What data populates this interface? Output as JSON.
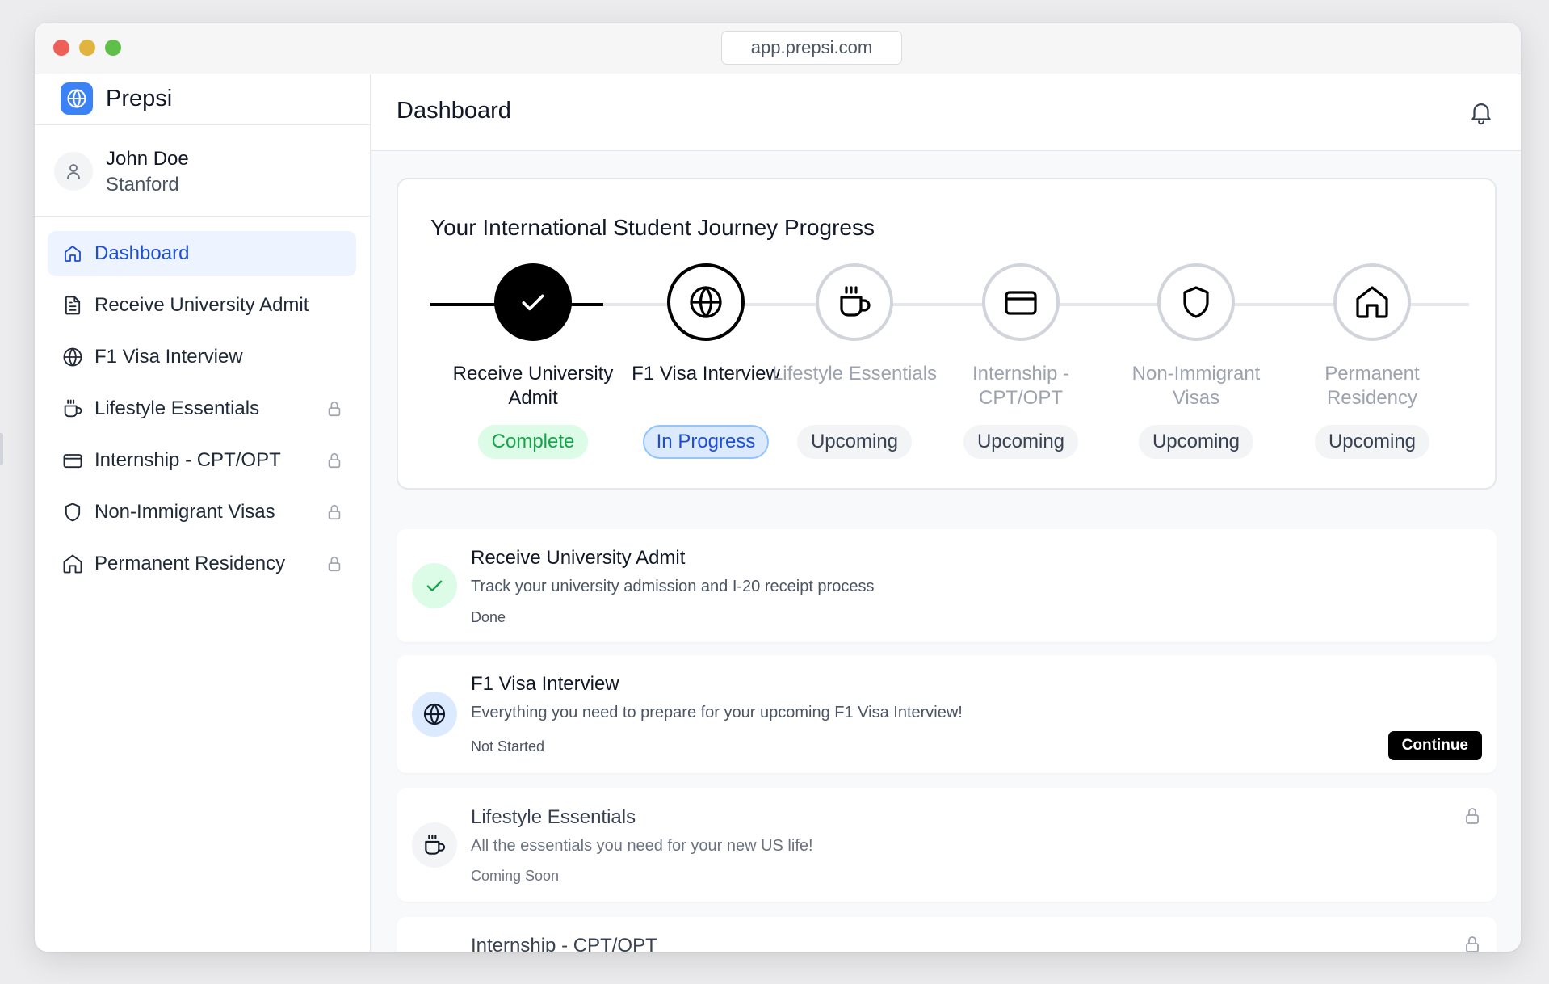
{
  "browser": {
    "url": "app.prepsi.com"
  },
  "brand": {
    "name": "Prepsi",
    "icon": "globe-icon",
    "color": "#3b82f6"
  },
  "user": {
    "name": "John Doe",
    "school": "Stanford",
    "icon": "user-icon"
  },
  "sidebar": {
    "items": [
      {
        "label": "Dashboard",
        "icon": "home-icon",
        "active": true,
        "locked": false
      },
      {
        "label": "Receive University Admit",
        "icon": "document-icon",
        "active": false,
        "locked": false
      },
      {
        "label": "F1 Visa Interview",
        "icon": "globe-icon",
        "active": false,
        "locked": false
      },
      {
        "label": "Lifestyle Essentials",
        "icon": "coffee-icon",
        "active": false,
        "locked": true
      },
      {
        "label": "Internship - CPT/OPT",
        "icon": "credit-card-icon",
        "active": false,
        "locked": true
      },
      {
        "label": "Non-Immigrant Visas",
        "icon": "shield-icon",
        "active": false,
        "locked": true
      },
      {
        "label": "Permanent Residency",
        "icon": "home-icon",
        "active": false,
        "locked": true
      }
    ]
  },
  "header": {
    "title": "Dashboard",
    "icon": "bell-icon"
  },
  "progress": {
    "title": "Your International Student Journey Progress",
    "steps": [
      {
        "label": "Receive University Admit",
        "status": "Complete",
        "state": "complete",
        "icon": "check-icon"
      },
      {
        "label": "F1 Visa Interview",
        "status": "In Progress",
        "state": "inprogress",
        "icon": "globe-icon"
      },
      {
        "label": "Lifestyle Essentials",
        "status": "Upcoming",
        "state": "upcoming",
        "icon": "coffee-icon"
      },
      {
        "label": "Internship - CPT/OPT",
        "status": "Upcoming",
        "state": "upcoming",
        "icon": "credit-card-icon"
      },
      {
        "label": "Non-Immigrant Visas",
        "status": "Upcoming",
        "state": "upcoming",
        "icon": "shield-icon"
      },
      {
        "label": "Permanent Residency",
        "status": "Upcoming",
        "state": "upcoming",
        "icon": "home-icon"
      }
    ]
  },
  "tasks": [
    {
      "title": "Receive University Admit",
      "description": "Track your university admission and I-20 receipt process",
      "status": "Done",
      "icon": "check-icon",
      "locked": false
    },
    {
      "title": "F1 Visa Interview",
      "description": "Everything you need to prepare for your upcoming F1 Visa Interview!",
      "status": "Not Started",
      "icon": "globe-icon",
      "locked": false,
      "button": "Continue"
    },
    {
      "title": "Lifestyle Essentials",
      "description": "All the essentials you need for your new US life!",
      "status": "Coming Soon",
      "icon": "coffee-icon",
      "locked": true
    },
    {
      "title": "Internship - CPT/OPT",
      "icon": "credit-card-icon",
      "locked": true
    }
  ],
  "colors": {
    "accent": "#1d4ed8",
    "complete": "#16a34a",
    "complete_bg": "#dcfce7",
    "inprogress_bg": "#dbeafe",
    "border": "#e5e7eb"
  }
}
